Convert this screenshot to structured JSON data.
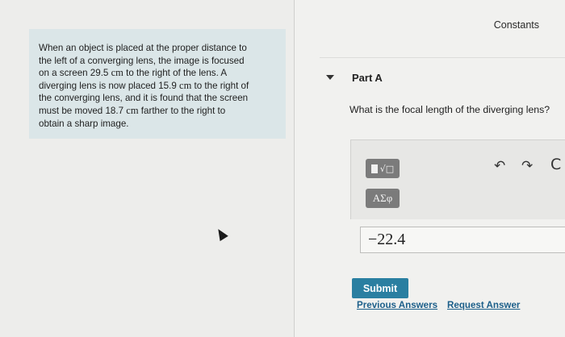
{
  "problem": {
    "lines": [
      "When an object is placed at the proper distance to",
      "the left of a converging lens, the image is focused",
      "on a screen 29.5 |cm| to the right of the lens. A",
      "diverging lens is now placed 15.9 |cm| to the right of",
      "the converging lens, and it is found that the screen",
      "must be moved 18.7 |cm| farther to the right to",
      "obtain a sharp image."
    ]
  },
  "header": {
    "constants_label": "Constants"
  },
  "part": {
    "label": "Part A"
  },
  "question": {
    "text": "What is the focal length of the diverging lens?"
  },
  "toolbar": {
    "templates_label": "√□",
    "greek_label": "ΑΣφ",
    "undo_glyph": "↶",
    "redo_glyph": "↷",
    "reset_glyph": "C"
  },
  "answer": {
    "value": "−22.4"
  },
  "actions": {
    "submit_label": "Submit",
    "previous_answers_label": "Previous Answers",
    "request_answer_label": "Request Answer"
  }
}
